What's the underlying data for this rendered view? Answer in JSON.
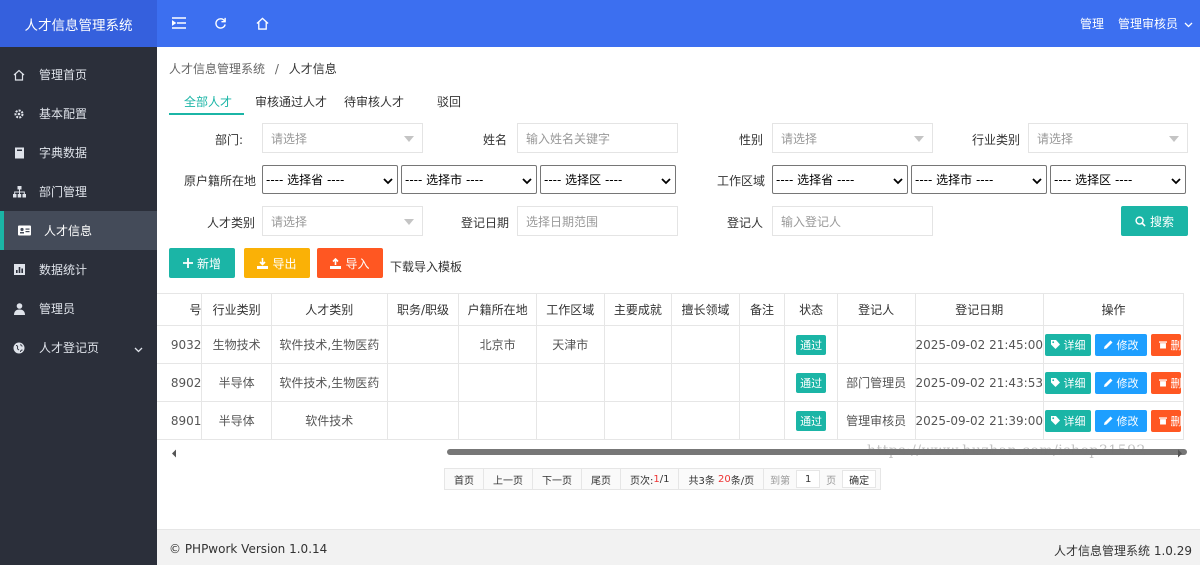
{
  "app_title": "人才信息管理系统",
  "header": {
    "manage_label": "管理",
    "user_label": "管理审核员"
  },
  "sidebar": {
    "items": [
      {
        "label": "管理首页",
        "icon": "home-icon"
      },
      {
        "label": "基本配置",
        "icon": "gear-icon"
      },
      {
        "label": "字典数据",
        "icon": "book-icon"
      },
      {
        "label": "部门管理",
        "icon": "sitemap-icon"
      },
      {
        "label": "人才信息",
        "icon": "id-card-icon"
      },
      {
        "label": "数据统计",
        "icon": "bar-chart-icon"
      },
      {
        "label": "管理员",
        "icon": "user-icon"
      },
      {
        "label": "人才登记页",
        "icon": "globe-icon"
      }
    ]
  },
  "breadcrumb": {
    "root": "人才信息管理系统",
    "sep": "/",
    "current": "人才信息"
  },
  "tabs": [
    "全部人才",
    "审核通过人才",
    "待审核人才",
    "驳回"
  ],
  "filters": {
    "dept_label": "部门:",
    "dept_placeholder": "请选择",
    "name_label": "姓名",
    "name_placeholder": "输入姓名关键字",
    "gender_label": "性别",
    "gender_placeholder": "请选择",
    "industry_label": "行业类别",
    "industry_placeholder": "请选择",
    "household_label": "原户籍所在地",
    "work_area_label": "工作区域",
    "province_opt": "---- 选择省 ----",
    "city_opt": "---- 选择市 ----",
    "district_opt": "---- 选择区 ----",
    "talent_type_label": "人才类别",
    "talent_type_placeholder": "请选择",
    "reg_date_label": "登记日期",
    "reg_date_placeholder": "选择日期范围",
    "registrar_label": "登记人",
    "registrar_placeholder": "输入登记人",
    "search_button": "搜索"
  },
  "toolbar": {
    "add": "新增",
    "export": "导出",
    "import": "导入",
    "template_link": "下载导入模板"
  },
  "table": {
    "headers": [
      "号",
      "行业类别",
      "人才类别",
      "职务/职级",
      "户籍所在地",
      "工作区域",
      "主要成就",
      "擅长领域",
      "备注",
      "状态",
      "登记人",
      "登记日期",
      "操作"
    ],
    "rows": [
      {
        "id": "9032",
        "industry": "生物技术",
        "talent_type": "软件技术,生物医药",
        "position": "",
        "household": "北京市",
        "work_area": "天津市",
        "achievement": "",
        "expertise": "",
        "remark": "",
        "status": "通过",
        "registrar": "",
        "date": "2025-09-02 21:45:00"
      },
      {
        "id": "8902",
        "industry": "半导体",
        "talent_type": "软件技术,生物医药",
        "position": "",
        "household": "",
        "work_area": "",
        "achievement": "",
        "expertise": "",
        "remark": "",
        "status": "通过",
        "registrar": "部门管理员",
        "date": "2025-09-02 21:43:53"
      },
      {
        "id": "8901",
        "industry": "半导体",
        "talent_type": "软件技术",
        "position": "",
        "household": "",
        "work_area": "",
        "achievement": "",
        "expertise": "",
        "remark": "",
        "status": "通过",
        "registrar": "管理审核员",
        "date": "2025-09-02 21:39:00"
      }
    ],
    "ops": {
      "detail": "详细",
      "edit": "修改",
      "delete": "删"
    }
  },
  "watermark": "https://www.huzhan.com/ishop31592",
  "pager": {
    "first": "首页",
    "prev": "上一页",
    "next": "下一页",
    "last": "尾页",
    "page_text_prefix": "页次:",
    "page_current": "1",
    "page_total": "/1",
    "total_prefix": "共3条",
    "per_page": "20",
    "per_page_suffix": "条/页",
    "goto_label": "到第",
    "goto_value": "1",
    "goto_unit": "页",
    "confirm": "确定"
  },
  "footer": {
    "left": "© PHPwork Version 1.0.14",
    "right": "人才信息管理系统 1.0.29"
  },
  "colors": {
    "topbar": "#3c6ff0",
    "sidebar": "#2b2f3a",
    "accent": "#1bb5a6",
    "orange": "#fab106",
    "red": "#ff5722",
    "blue": "#1e9fff"
  }
}
